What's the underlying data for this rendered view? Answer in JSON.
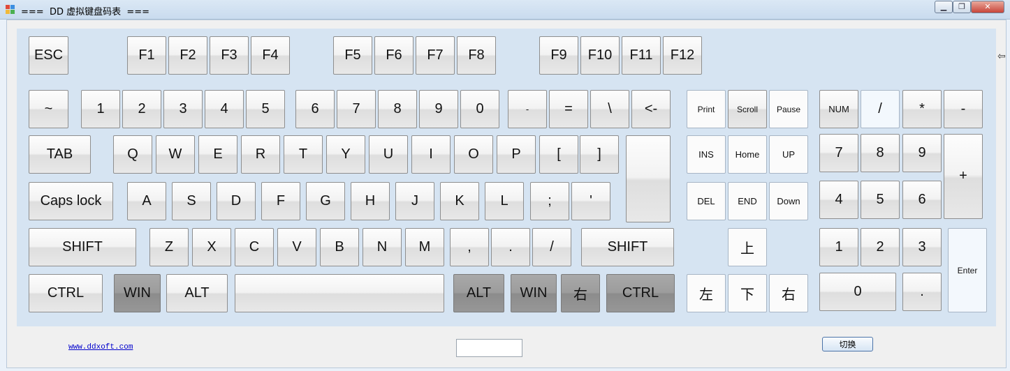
{
  "window": {
    "title": "===  DD 虚拟键盘码表  ===",
    "minimize_glyph": "▁",
    "restore_glyph": "❐",
    "close_glyph": "✕",
    "edge_arrow_glyph": "⇦"
  },
  "keys": {
    "esc": "ESC",
    "f1": "F1",
    "f2": "F2",
    "f3": "F3",
    "f4": "F4",
    "f5": "F5",
    "f6": "F6",
    "f7": "F7",
    "f8": "F8",
    "f9": "F9",
    "f10": "F10",
    "f11": "F11",
    "f12": "F12",
    "tilde": "~",
    "n1": "1",
    "n2": "2",
    "n3": "3",
    "n4": "4",
    "n5": "5",
    "n6": "6",
    "n7": "7",
    "n8": "8",
    "n9": "9",
    "n0": "0",
    "minus": "-",
    "equals": "=",
    "backslash": "\\",
    "backspace": "<-",
    "tab": "TAB",
    "q": "Q",
    "w": "W",
    "e": "E",
    "r": "R",
    "t": "T",
    "y": "Y",
    "u": "U",
    "i": "I",
    "o": "O",
    "p": "P",
    "lbracket": "[",
    "rbracket": "]",
    "enter": "",
    "caps": "Caps lock",
    "a": "A",
    "s": "S",
    "d": "D",
    "f": "F",
    "g": "G",
    "h": "H",
    "j": "J",
    "k": "K",
    "l": "L",
    "semicolon": ";",
    "quote": "'",
    "lshift": "SHIFT",
    "z": "Z",
    "x": "X",
    "c": "C",
    "v": "V",
    "b": "B",
    "n": "N",
    "m": "M",
    "comma": ",",
    "period": ".",
    "slash": "/",
    "rshift": "SHIFT",
    "lctrl": "CTRL",
    "lwin": "WIN",
    "lalt": "ALT",
    "space": "",
    "ralt": "ALT",
    "rwin": "WIN",
    "menu": "右",
    "rctrl": "CTRL",
    "print": "Print",
    "scroll": "Scroll",
    "pause": "Pause",
    "ins": "INS",
    "home": "Home",
    "pgup": "UP",
    "del": "DEL",
    "end": "END",
    "pgdn": "Down",
    "up": "上",
    "left": "左",
    "down": "下",
    "right": "右",
    "numlock": "NUM",
    "num_div": "/",
    "num_mul": "*",
    "num_sub": "-",
    "num7": "7",
    "num8": "8",
    "num9": "9",
    "num_add": "+",
    "num4": "4",
    "num5": "5",
    "num6": "6",
    "num1": "1",
    "num2": "2",
    "num3": "3",
    "num_enter": "Enter",
    "num0": "0",
    "num_dot": "."
  },
  "footer": {
    "link": "www.ddxoft.com",
    "code_value": "",
    "switch_label": "切换"
  }
}
